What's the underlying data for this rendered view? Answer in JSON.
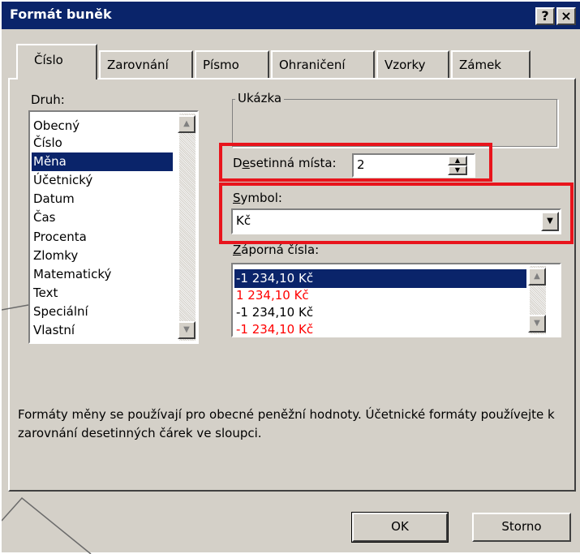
{
  "window": {
    "title": "Formát buněk",
    "help_label": "?",
    "close_label": "×"
  },
  "tabs": [
    {
      "label": "Číslo",
      "active": true
    },
    {
      "label": "Zarovnání",
      "active": false
    },
    {
      "label": "Písmo",
      "active": false
    },
    {
      "label": "Ohraničení",
      "active": false
    },
    {
      "label": "Vzorky",
      "active": false
    },
    {
      "label": "Zámek",
      "active": false
    }
  ],
  "category": {
    "label": "Druh:",
    "items": [
      "Obecný",
      "Číslo",
      "Měna",
      "Účetnický",
      "Datum",
      "Čas",
      "Procenta",
      "Zlomky",
      "Matematický",
      "Text",
      "Speciální",
      "Vlastní"
    ],
    "selected": "Měna"
  },
  "sample": {
    "label": "Ukázka",
    "value": ""
  },
  "decimal_places": {
    "label": "Desetinná místa:",
    "value": "2"
  },
  "symbol": {
    "label": "Symbol:",
    "value": "Kč"
  },
  "negative_numbers": {
    "label": "Záporná čísla:",
    "items": [
      {
        "text": "-1 234,10 Kč",
        "color": "#000000",
        "selected": true
      },
      {
        "text": "1 234,10 Kč",
        "color": "#ff0000",
        "selected": false
      },
      {
        "text": "-1 234,10 Kč",
        "color": "#000000",
        "selected": false
      },
      {
        "text": "-1 234,10 Kč",
        "color": "#ff0000",
        "selected": false
      }
    ]
  },
  "description": "Formáty měny se používají pro obecné peněžní hodnoty. Účetnické formáty používejte k zarovnání desetinných čárek ve sloupci.",
  "buttons": {
    "ok": "OK",
    "cancel": "Storno"
  },
  "colors": {
    "titlebar": "#0a246a",
    "selection": "#0a246a",
    "face": "#d4d0c8",
    "highlight_box": "#e8141c"
  }
}
